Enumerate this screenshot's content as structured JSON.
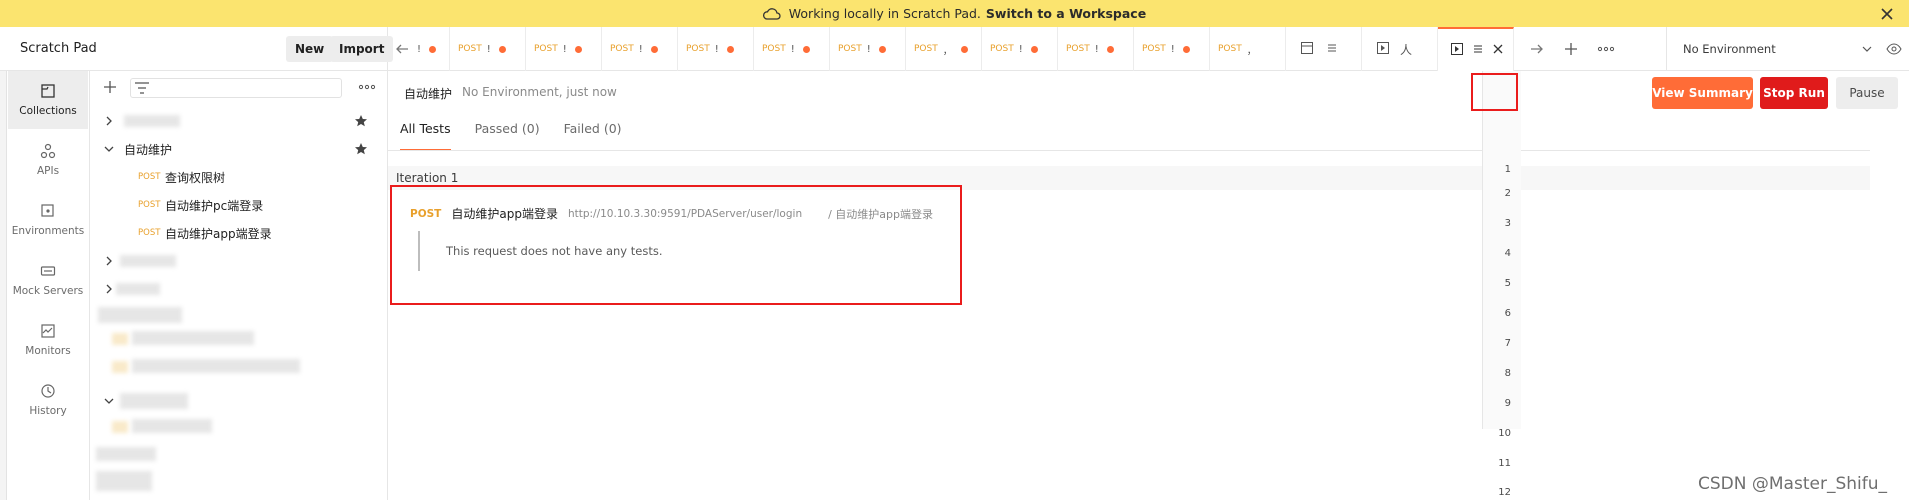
{
  "banner": {
    "text": "Working locally in Scratch Pad.",
    "link": "Switch to a Workspace",
    "icon": "cloud-off-icon",
    "bg": "#fbe46f"
  },
  "app": {
    "title": "Scratch Pad",
    "new_label": "New",
    "import_label": "Import"
  },
  "nav": {
    "items": [
      {
        "label": "Collections",
        "icon": "collections-icon"
      },
      {
        "label": "APIs",
        "icon": "apis-icon"
      },
      {
        "label": "Environments",
        "icon": "environments-icon"
      },
      {
        "label": "Mock Servers",
        "icon": "mock-servers-icon"
      },
      {
        "label": "Monitors",
        "icon": "monitors-icon"
      },
      {
        "label": "History",
        "icon": "history-icon"
      }
    ]
  },
  "tree": {
    "folder_name": "自动维护",
    "requests": [
      {
        "method": "POST",
        "name": "查询权限树"
      },
      {
        "method": "POST",
        "name": "自动维护pc端登录"
      },
      {
        "method": "POST",
        "name": "自动维护app端登录"
      }
    ]
  },
  "tabs": {
    "items": [
      {
        "method": "",
        "text": "!"
      },
      {
        "method": "POST",
        "text": "!"
      },
      {
        "method": "POST",
        "text": "!"
      },
      {
        "method": "POST",
        "text": "!"
      },
      {
        "method": "POST",
        "text": "!"
      },
      {
        "method": "POST",
        "text": "!"
      },
      {
        "method": "POST",
        "text": "!"
      },
      {
        "method": "POST",
        "text": "，"
      },
      {
        "method": "POST",
        "text": "!"
      },
      {
        "method": "POST",
        "text": "!"
      },
      {
        "method": "POST",
        "text": "!"
      },
      {
        "method": "POST",
        "text": "，"
      }
    ],
    "runner_tab_text": "人",
    "environment": "No Environment"
  },
  "runner": {
    "collection": "自动维护",
    "env_status": "No Environment, just now",
    "view_summary": "View Summary",
    "stop_run": "Stop Run",
    "pause": "Pause",
    "filters": {
      "all": "All Tests",
      "passed": "Passed (0)",
      "failed": "Failed (0)"
    },
    "iteration_label": "Iteration 1",
    "result": {
      "method": "POST",
      "name": "自动维护app端登录",
      "url": "http://10.10.3.30:9591/PDAServer/user/login",
      "path": "/ 自动维护app端登录",
      "message": "This request does not have any tests."
    },
    "iterations": [
      "1",
      "2",
      "3",
      "4",
      "5",
      "6",
      "7",
      "8",
      "9",
      "10",
      "11",
      "12"
    ]
  },
  "colors": {
    "accent": "#ff6c37",
    "stop": "#e01b1b",
    "highlight": "#ea1c1c",
    "method_post": "#e8a02c"
  },
  "watermark": "CSDN @Master_Shifu_"
}
